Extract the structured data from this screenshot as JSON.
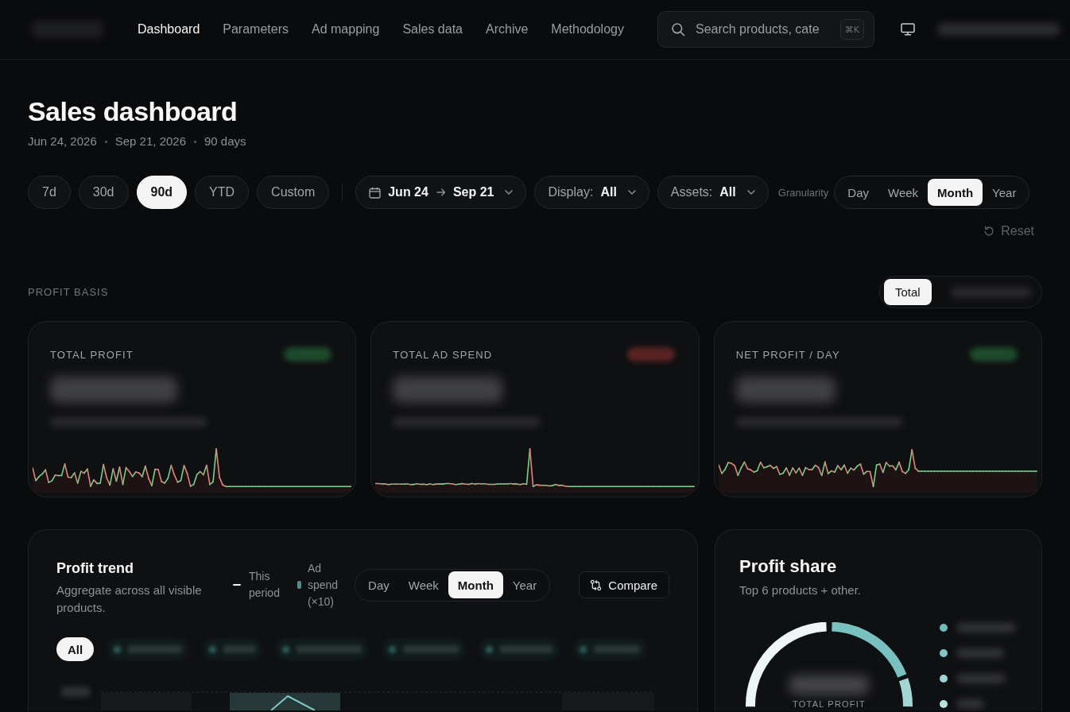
{
  "nav": {
    "items": [
      {
        "label": "Dashboard",
        "selected": true
      },
      {
        "label": "Parameters",
        "selected": false
      },
      {
        "label": "Ad mapping",
        "selected": false
      },
      {
        "label": "Sales data",
        "selected": false
      },
      {
        "label": "Archive",
        "selected": false
      },
      {
        "label": "Methodology",
        "selected": false
      }
    ],
    "search": {
      "placeholder": "Search products, cate",
      "shortcut": "⌘K"
    }
  },
  "header": {
    "title": "Sales dashboard",
    "date_start": "Jun 24, 2026",
    "date_end": "Sep 21, 2026",
    "span": "90 days"
  },
  "filters": {
    "presets": [
      {
        "label": "7d",
        "selected": false
      },
      {
        "label": "30d",
        "selected": false
      },
      {
        "label": "90d",
        "selected": true
      },
      {
        "label": "YTD",
        "selected": false
      },
      {
        "label": "Custom",
        "selected": false
      }
    ],
    "date_range": {
      "start": "Jun 24",
      "end": "Sep 21"
    },
    "dropdowns": [
      {
        "label": "Display:",
        "value": "All"
      },
      {
        "label": "Assets:",
        "value": "All"
      }
    ],
    "granularity_label": "Granularity",
    "granularity": [
      {
        "label": "Day",
        "selected": false
      },
      {
        "label": "Week",
        "selected": false
      },
      {
        "label": "Month",
        "selected": true
      },
      {
        "label": "Year",
        "selected": false
      }
    ],
    "reset": "Reset"
  },
  "profit_basis": {
    "label": "PROFIT BASIS",
    "options": [
      {
        "label": "Total",
        "selected": true
      },
      {
        "selected": false
      }
    ]
  },
  "kpi_cards": [
    {
      "title": "TOTAL PROFIT",
      "color": "#1d4a2b"
    },
    {
      "title": "TOTAL AD SPEND",
      "color": "#5a2323"
    },
    {
      "title": "NET PROFIT / DAY",
      "color": "#1d4a2b"
    }
  ],
  "profit_trend": {
    "title": "Profit trend",
    "subtitle": "Aggregate across all visible products.",
    "legend": [
      {
        "kind": "line",
        "label": "This period"
      },
      {
        "kind": "bar",
        "label": "Ad spend (×10)"
      }
    ],
    "granularity": [
      {
        "label": "Day",
        "selected": false
      },
      {
        "label": "Week",
        "selected": false
      },
      {
        "label": "Month",
        "selected": true
      },
      {
        "label": "Year",
        "selected": false
      }
    ],
    "compare": "Compare",
    "chips": [
      {
        "label": "All",
        "selected": true
      },
      {
        "selected": false
      },
      {
        "selected": false
      },
      {
        "selected": false
      },
      {
        "selected": false
      },
      {
        "selected": false
      },
      {
        "selected": false
      }
    ]
  },
  "profit_share": {
    "title": "Profit share",
    "subtitle": "Top 6 products + other.",
    "center_label": "TOTAL PROFIT",
    "legend": [
      {
        "color": "#6fbcbc"
      },
      {
        "color": "#82c6c5"
      },
      {
        "color": "#9dd3d2"
      },
      {
        "color": "#b9e1e0"
      }
    ]
  }
}
